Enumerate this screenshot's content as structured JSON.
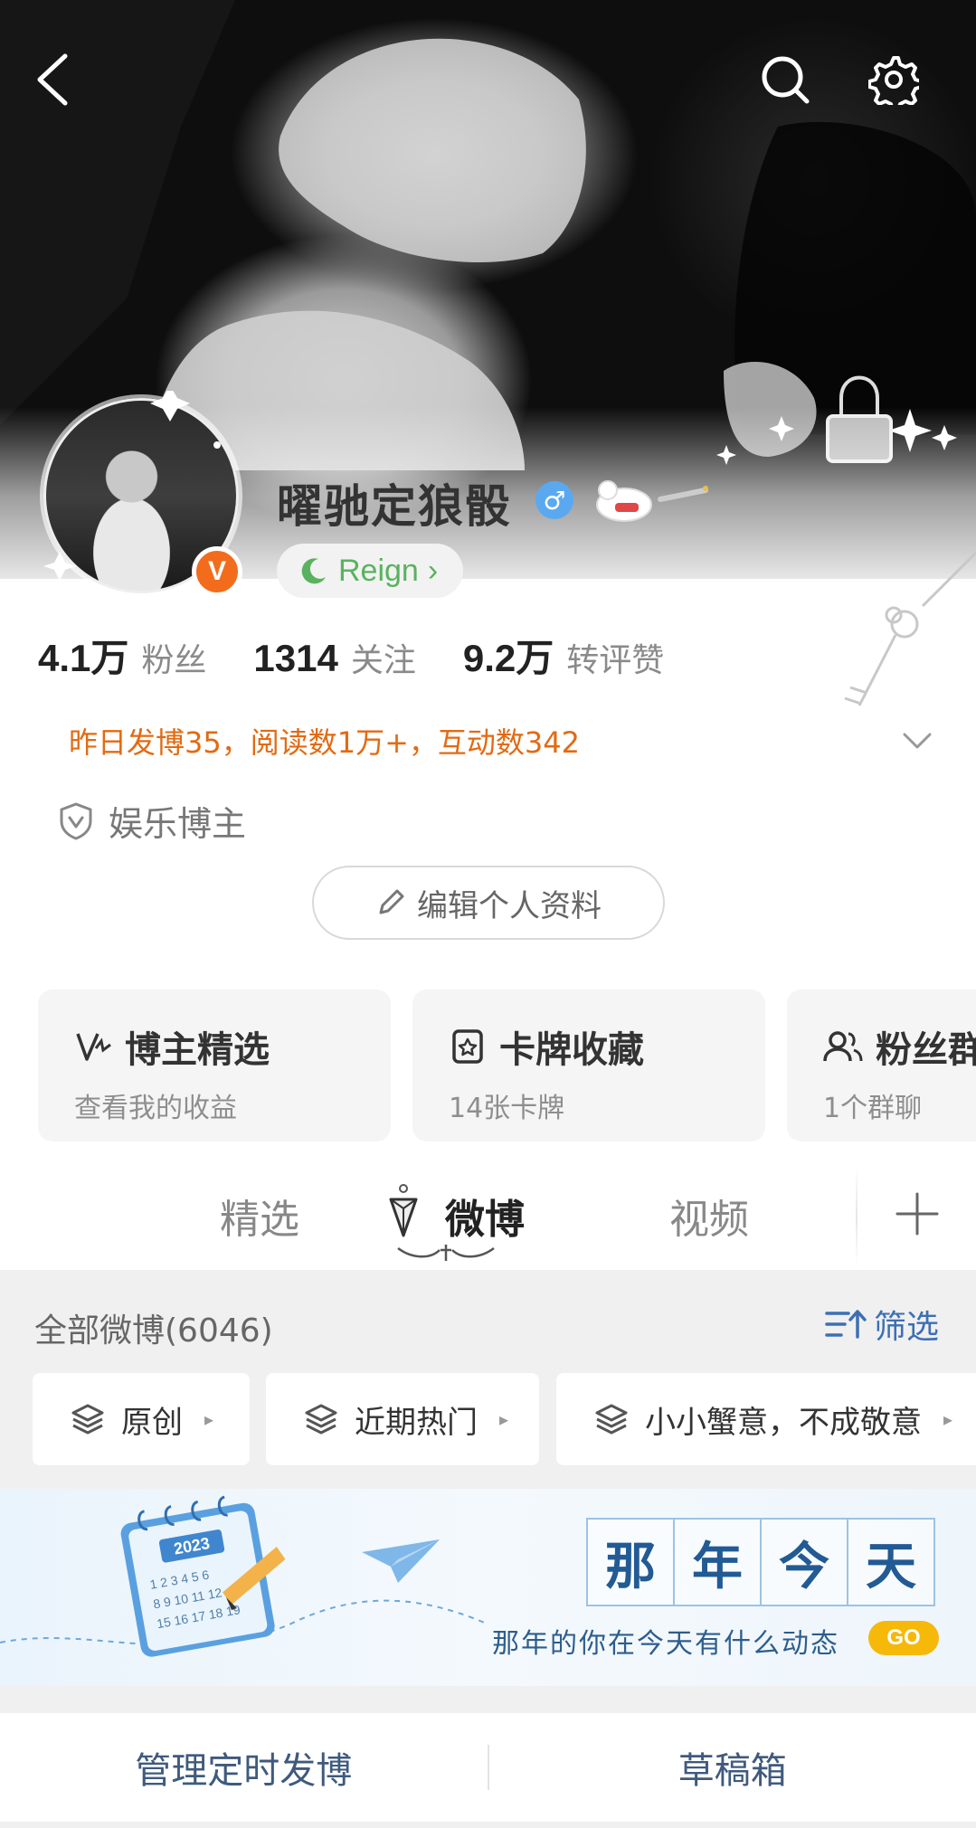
{
  "profile": {
    "nickname": "曜驰定狼骰",
    "gender_symbol": "♂",
    "vip_badge": "V",
    "reign_label": "Reign",
    "reign_arrow": "›",
    "stats": [
      {
        "value": "4.1万",
        "label": "粉丝"
      },
      {
        "value": "1314",
        "label": "关注"
      },
      {
        "value": "9.2万",
        "label": "转评赞"
      }
    ],
    "yesterday_summary": "昨日发博35，阅读数1万+，互动数342",
    "tag": "娱乐博主",
    "edit_button": "编辑个人资料"
  },
  "cards": [
    {
      "title": "博主精选",
      "subtitle": "查看我的收益",
      "icon": "crown-check-icon"
    },
    {
      "title": "卡牌收藏",
      "subtitle": "14张卡牌",
      "icon": "card-star-icon"
    },
    {
      "title": "粉丝群",
      "subtitle": "1个群聊",
      "icon": "group-icon"
    }
  ],
  "tabs": {
    "items": [
      "精选",
      "微博",
      "视频"
    ],
    "active": "微博",
    "add_symbol": "+"
  },
  "feed": {
    "count_label": "全部微博(6046)",
    "filter_label": "筛选",
    "chips": [
      "原创",
      "近期热门",
      "小小蟹意，不成敬意"
    ],
    "chip_arrow": "▸"
  },
  "memory_banner": {
    "title_chars": [
      "那",
      "年",
      "今",
      "天"
    ],
    "subtitle": "那年的你在今天有什么动态",
    "go_label": "GO",
    "calendar_year": "2023"
  },
  "bottom_actions": {
    "left": "管理定时发博",
    "right": "草稿箱"
  },
  "colors": {
    "accent_orange": "#e36a12",
    "vip_orange": "#f26c1c",
    "reign_green": "#59b25e",
    "link_blue": "#3d6fb4",
    "go_yellow": "#f6b90a"
  }
}
